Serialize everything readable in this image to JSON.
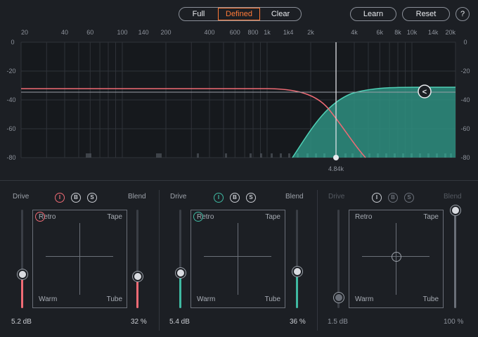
{
  "toolbar": {
    "modes": [
      "Full",
      "Defined",
      "Clear"
    ],
    "active_mode": "Defined",
    "learn_label": "Learn",
    "reset_label": "Reset",
    "help_label": "?"
  },
  "graph": {
    "freq_labels": [
      "20",
      "40",
      "60",
      "100",
      "140",
      "200",
      "400",
      "600",
      "800",
      "1k",
      "1k4",
      "2k",
      "4k",
      "6k",
      "8k",
      "10k",
      "14k",
      "20k"
    ],
    "db_labels": [
      "0",
      "-20",
      "-40",
      "-60",
      "-80"
    ],
    "crossover_label": "4.84k",
    "handle_glyph": "<"
  },
  "colors": {
    "accent_orange": "#ff7a38",
    "band1": "#f06b75",
    "band2": "#3fb9a2",
    "band2_fill": "#2e8f80"
  },
  "bands": [
    {
      "drive_label": "Drive",
      "blend_label": "Blend",
      "icons": [
        "I",
        "B",
        "S"
      ],
      "pad": {
        "retro": "Retro",
        "tape": "Tape",
        "warm": "Warm",
        "tube": "Tube"
      },
      "drive_value": "5.2 dB",
      "blend_value": "32 %",
      "drive_level": 0.32,
      "blend_level": 0.32
    },
    {
      "drive_label": "Drive",
      "blend_label": "Blend",
      "icons": [
        "I",
        "B",
        "S"
      ],
      "pad": {
        "retro": "Retro",
        "tape": "Tape",
        "warm": "Warm",
        "tube": "Tube"
      },
      "drive_value": "5.4 dB",
      "blend_value": "36 %",
      "drive_level": 0.33,
      "blend_level": 0.36
    },
    {
      "drive_label": "Drive",
      "blend_label": "Blend",
      "icons": [
        "I",
        "B",
        "S"
      ],
      "pad": {
        "retro": "Retro",
        "tape": "Tape",
        "warm": "Warm",
        "tube": "Tube"
      },
      "drive_value": "1.5 dB",
      "blend_value": "100 %",
      "drive_level": 0.1,
      "blend_level": 1.0
    }
  ]
}
